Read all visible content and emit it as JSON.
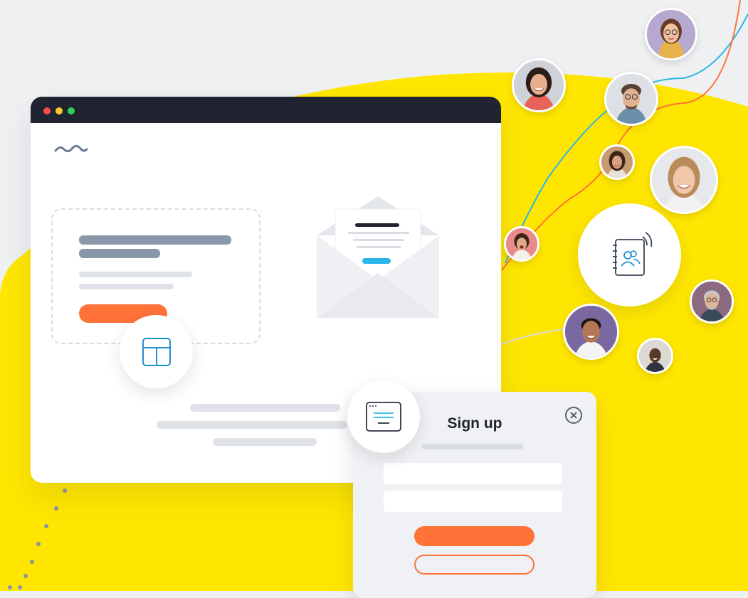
{
  "signup_popup": {
    "title": "Sign up"
  },
  "icons": {
    "logo": "wave-logo-icon",
    "layout": "layout-grid-icon",
    "form": "form-window-icon",
    "envelope": "envelope-letter-icon",
    "contacts": "contacts-book-icon",
    "close": "close-circle-icon"
  },
  "colors": {
    "accent_yellow": "#ffe600",
    "accent_orange": "#ff7238",
    "line_blue": "#29b6e8",
    "titlebar": "#1f2430"
  }
}
